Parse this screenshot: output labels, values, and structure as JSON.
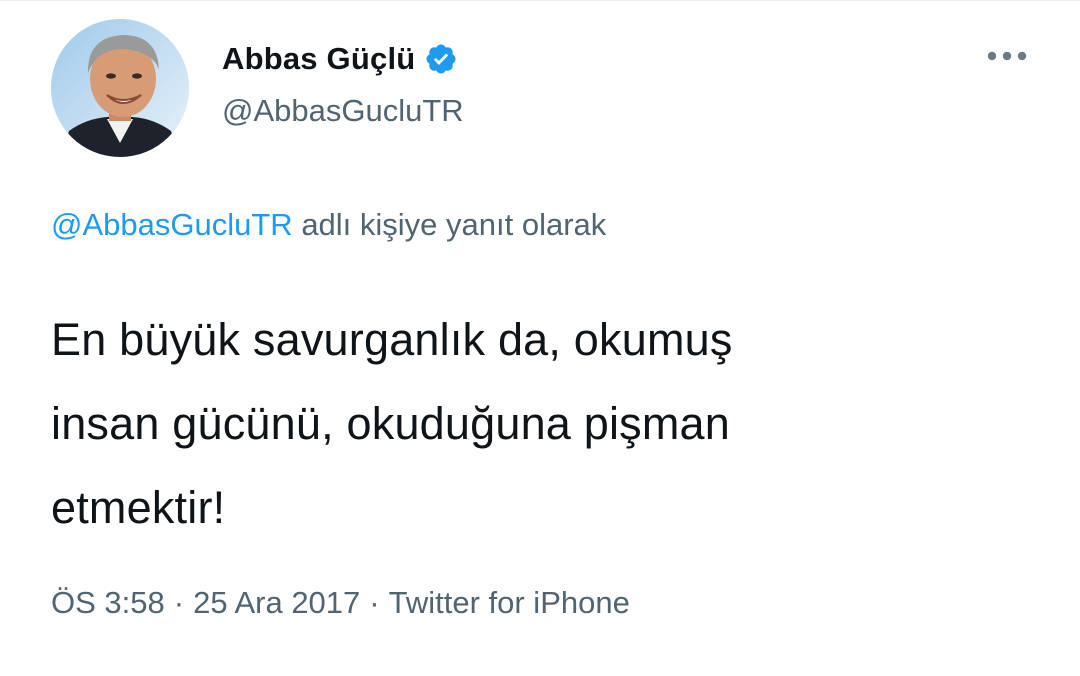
{
  "author": {
    "display_name": "Abbas Güçlü",
    "handle": "@AbbasGucluTR",
    "verified": true,
    "avatar_icon": "profile-photo"
  },
  "reply_context": {
    "target_handle": "@AbbasGucluTR",
    "suffix": "adlı kişiye yanıt olarak"
  },
  "tweet": {
    "text": "En büyük savurganlık  da, okumuş\ninsan gücünü, okuduğuna pişman\netmektir!"
  },
  "meta": {
    "time": "ÖS 3:58",
    "separator": "·",
    "date": "25 Ara 2017",
    "source": "Twitter for iPhone"
  },
  "icons": {
    "verified": "verified-badge-icon",
    "more": "more-options-icon"
  },
  "colors": {
    "accent": "#1d9bf0",
    "text_primary": "#0f1419",
    "text_secondary": "#536471",
    "background": "#ffffff"
  }
}
